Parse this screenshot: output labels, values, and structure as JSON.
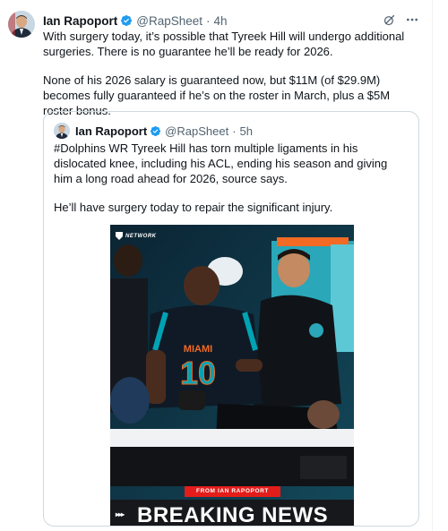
{
  "tweet": {
    "author_name": "Ian Rapoport",
    "handle": "@RapSheet",
    "separator": "·",
    "time": "4h",
    "paragraphs": [
      "With surgery today, it’s possible that Tyreek Hill will undergo additional surgeries. There is no guarantee he’ll be ready for 2026.",
      "None of his 2026 salary is guaranteed now, but $11M (of $29.9M) becomes fully guaranteed if he’s on the roster in March, plus a $5M roster bonus."
    ]
  },
  "quoted_tweet": {
    "author_name": "Ian Rapoport",
    "handle": "@RapSheet",
    "separator": "·",
    "time": "5h",
    "paragraphs": [
      "#Dolphins WR Tyreek Hill has torn multiple ligaments in his dislocated knee, including his ACL, ending his season and giving him a long road ahead for 2026, source says.",
      "He’ll have surgery today to repair the significant injury."
    ]
  },
  "media": {
    "network_logo_text": "NETWORK",
    "jersey_team_text": "MIAMI",
    "jersey_number": "10",
    "source_banner": "FROM IAN RAPOPORT",
    "headline": "BREAKING NEWS",
    "headline_arrows": "▸▸▸"
  },
  "colors": {
    "verified_blue": "#1d9bf0",
    "secondary_text": "#536471",
    "banner_red": "#e31d1a",
    "dolphins_aqua": "#00a3b3",
    "dolphins_orange": "#f26a24"
  }
}
